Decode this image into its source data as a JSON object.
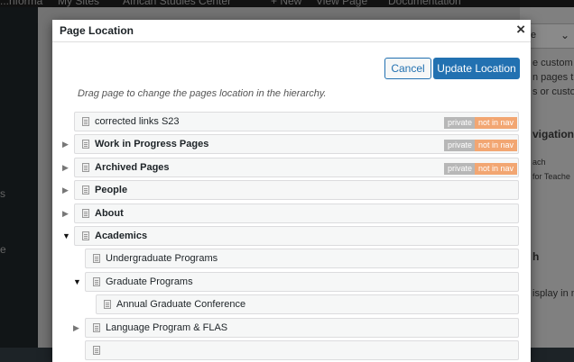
{
  "admin_bar": {
    "items": [
      "...nforma",
      "My Sites",
      "African Studies Center",
      "+ New",
      "View Page",
      "Documentation"
    ]
  },
  "left_nav": {
    "items": [
      "s",
      "e"
    ]
  },
  "right_panel": {
    "select_value": "te",
    "texts": [
      "e custom",
      "n pages th",
      "s or custo",
      "vigation",
      "ach",
      "for Teache",
      "h",
      "isplay in n"
    ]
  },
  "modal": {
    "title": "Page Location",
    "close_label": "×",
    "cancel_label": "Cancel",
    "update_label": "Update Location",
    "instructions": "Drag page to change the pages location in the hierarchy.",
    "badges": {
      "private": "private",
      "not_in_nav": "not in nav"
    },
    "pages": [
      {
        "label": "corrected links S23",
        "bold": false,
        "level": 0,
        "toggle": "",
        "private": true,
        "not_in_nav": true
      },
      {
        "label": "Work in Progress Pages",
        "bold": true,
        "level": 0,
        "toggle": "▶",
        "private": true,
        "not_in_nav": true
      },
      {
        "label": "Archived Pages",
        "bold": true,
        "level": 0,
        "toggle": "▶",
        "private": true,
        "not_in_nav": true
      },
      {
        "label": "People",
        "bold": true,
        "level": 0,
        "toggle": "▶",
        "private": false,
        "not_in_nav": false
      },
      {
        "label": "About",
        "bold": true,
        "level": 0,
        "toggle": "▶",
        "private": false,
        "not_in_nav": false
      },
      {
        "label": "Academics",
        "bold": true,
        "level": 0,
        "toggle": "▼",
        "private": false,
        "not_in_nav": false
      },
      {
        "label": "Undergraduate Programs",
        "bold": false,
        "level": 1,
        "toggle": "",
        "private": false,
        "not_in_nav": false
      },
      {
        "label": "Graduate Programs",
        "bold": false,
        "level": 1,
        "toggle": "▼",
        "private": false,
        "not_in_nav": false
      },
      {
        "label": "Annual Graduate Conference",
        "bold": false,
        "level": 2,
        "toggle": "",
        "private": false,
        "not_in_nav": false
      },
      {
        "label": "Language Program & FLAS",
        "bold": false,
        "level": 1,
        "toggle": "▶",
        "private": false,
        "not_in_nav": false
      },
      {
        "label": "",
        "bold": false,
        "level": 1,
        "toggle": "",
        "private": false,
        "not_in_nav": false
      }
    ]
  }
}
